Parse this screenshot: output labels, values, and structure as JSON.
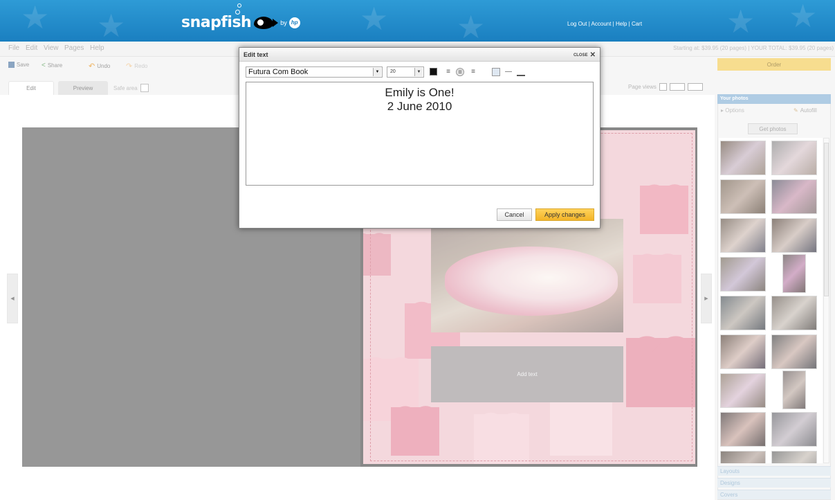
{
  "header": {
    "logo_text": "snapfish",
    "logo_by": "by",
    "logo_hp": "hp",
    "links": "Log Out | Account | Help | Cart"
  },
  "menu": [
    "File",
    "Edit",
    "View",
    "Pages",
    "Help"
  ],
  "price_text": "Starting at: $39.95 (20 pages) | YOUR TOTAL: $39.95 (20 pages)",
  "toolbar": {
    "save": "Save",
    "share": "Share",
    "undo": "Undo",
    "redo": "Redo"
  },
  "tabs": {
    "edit": "Edit",
    "preview": "Preview",
    "safe_area": "Safe area"
  },
  "page_views": "Page views",
  "order": "Order",
  "panel": {
    "title": "Your photos",
    "options": "Options",
    "autofill": "Autofill",
    "get_photos": "Get photos",
    "layouts": "Layouts",
    "designs": "Designs",
    "covers": "Covers"
  },
  "canvas": {
    "add_text": "Add text"
  },
  "dialog": {
    "title": "Edit text",
    "close": "CLOSE",
    "font": "Futura Com Book",
    "size": "20",
    "text_line1": "Emily is One!",
    "text_line2": "2 June 2010",
    "cancel": "Cancel",
    "apply": "Apply changes"
  },
  "colors": {
    "header": "#1a7fc0",
    "order": "#f4cf5f",
    "apply": "#f3b428",
    "page_bg": "#f0c8cf"
  }
}
